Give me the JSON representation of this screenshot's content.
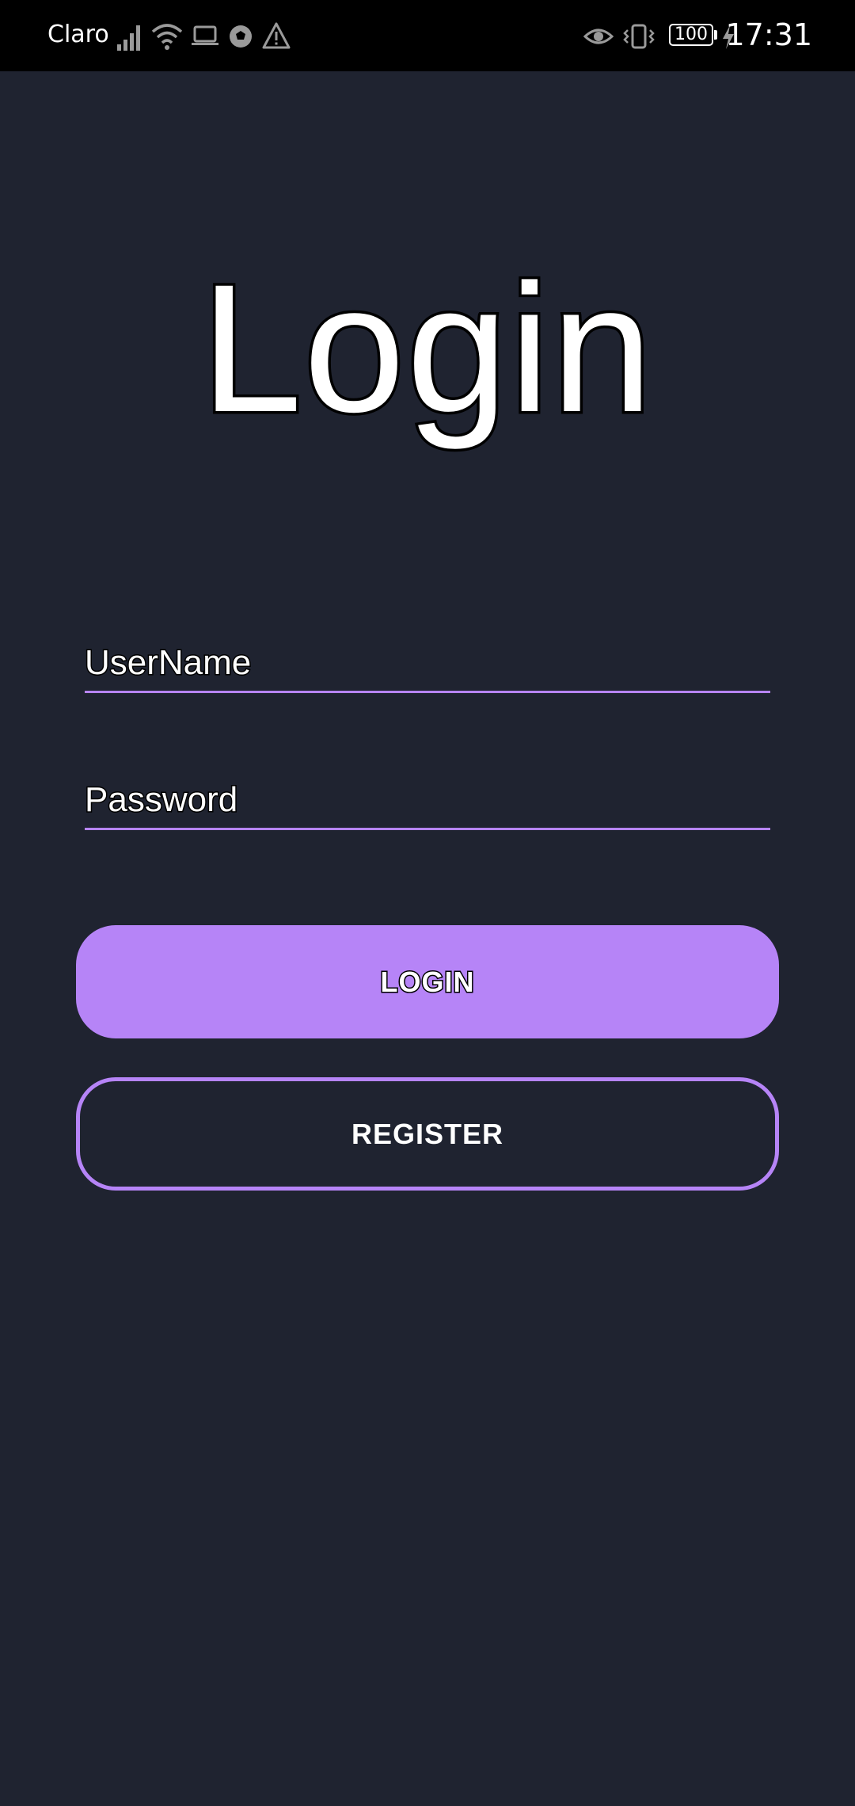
{
  "status_bar": {
    "carrier": "Claro",
    "battery": "100",
    "time": "17:31",
    "icons": [
      "signal-icon",
      "wifi-icon",
      "laptop-icon",
      "soccer-ball-icon",
      "warning-icon",
      "eye-icon",
      "vibrate-icon",
      "battery-icon",
      "charging-icon"
    ]
  },
  "screen": {
    "title": "Login",
    "username_placeholder": "UserName",
    "password_placeholder": "Password",
    "login_label": "LOGIN",
    "register_label": "REGISTER"
  },
  "colors": {
    "background": "#1f2330",
    "accent": "#b684f7",
    "status_bar": "#000000",
    "text": "#ffffff"
  }
}
